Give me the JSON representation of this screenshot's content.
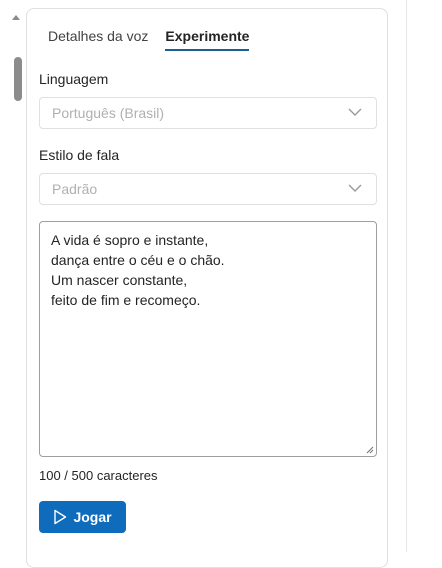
{
  "tabs": [
    {
      "label": "Detalhes da voz",
      "active": false
    },
    {
      "label": "Experimente",
      "active": true
    }
  ],
  "language": {
    "label": "Linguagem",
    "value": "Português (Brasil)"
  },
  "speaking_style": {
    "label": "Estilo de fala",
    "value": "Padrão"
  },
  "text_input": {
    "lines": [
      "A vida é sopro e instante,",
      "dança entre o céu e o chão.",
      "Um nascer constante,",
      "feito de fim e recomeço."
    ]
  },
  "counter": "100 / 500 caracteres",
  "play_button": {
    "label": "Jogar",
    "icon": "play-icon"
  },
  "colors": {
    "accent": "#0f6cbd",
    "tab_underline": "#1a5f8f"
  }
}
